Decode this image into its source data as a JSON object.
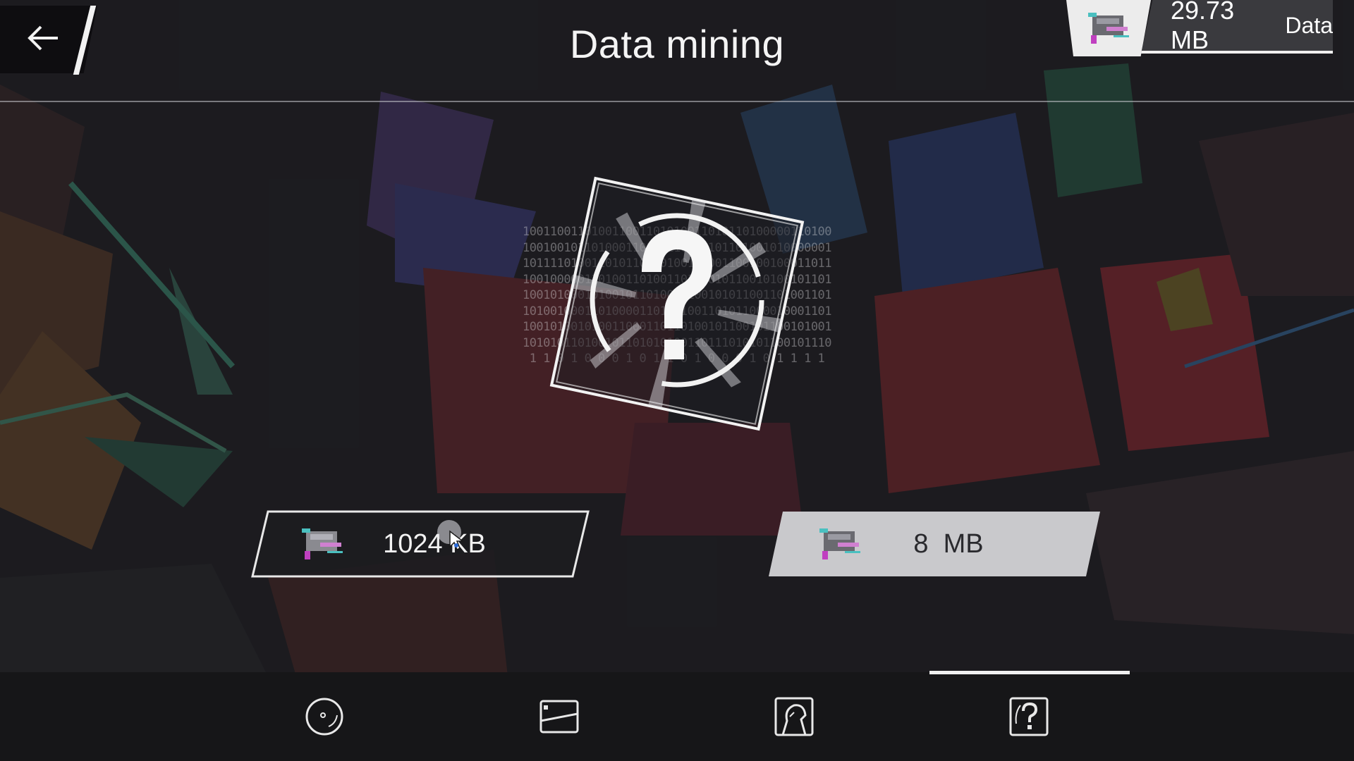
{
  "header": {
    "title": "Data mining",
    "back_icon": "arrow-left-icon",
    "data_counter": {
      "amount": "29.73 MB",
      "unit": "Data",
      "icon": "data-chip-icon"
    }
  },
  "emblem": {
    "icon": "question-mark-icon",
    "binary_lines": [
      "100110011010011001101010011010110100000110100",
      "100100101101000110100110100101101001010000001",
      "101111010011010110010100101001100100100011011",
      "100100000110100110100110100010110010100101101",
      "100101000101001011010010100101011001101001101",
      "101001000110100001101001001101011000010001101",
      "100101001010011000110110100101100101100101001",
      "101010110100101101010100110111010101100101110",
      "1 1 0 1 0 0 0 1 0 1 1 0 1 0 0 0 1 0 1 1 1 1"
    ]
  },
  "costs": [
    {
      "amount": "1024",
      "unit": "KB",
      "icon": "data-chip-icon"
    },
    {
      "amount": "8",
      "unit": "MB",
      "icon": "data-chip-icon"
    }
  ],
  "nav": {
    "items": [
      {
        "icon": "disc-icon",
        "active": false
      },
      {
        "icon": "card-icon",
        "active": false
      },
      {
        "icon": "character-portrait-icon",
        "active": false
      },
      {
        "icon": "mystery-question-icon",
        "active": true
      }
    ]
  },
  "colors": {
    "accent": "#f0f0f0",
    "nav_bg": "#161618",
    "panel_dark": "#3a3a3e"
  }
}
